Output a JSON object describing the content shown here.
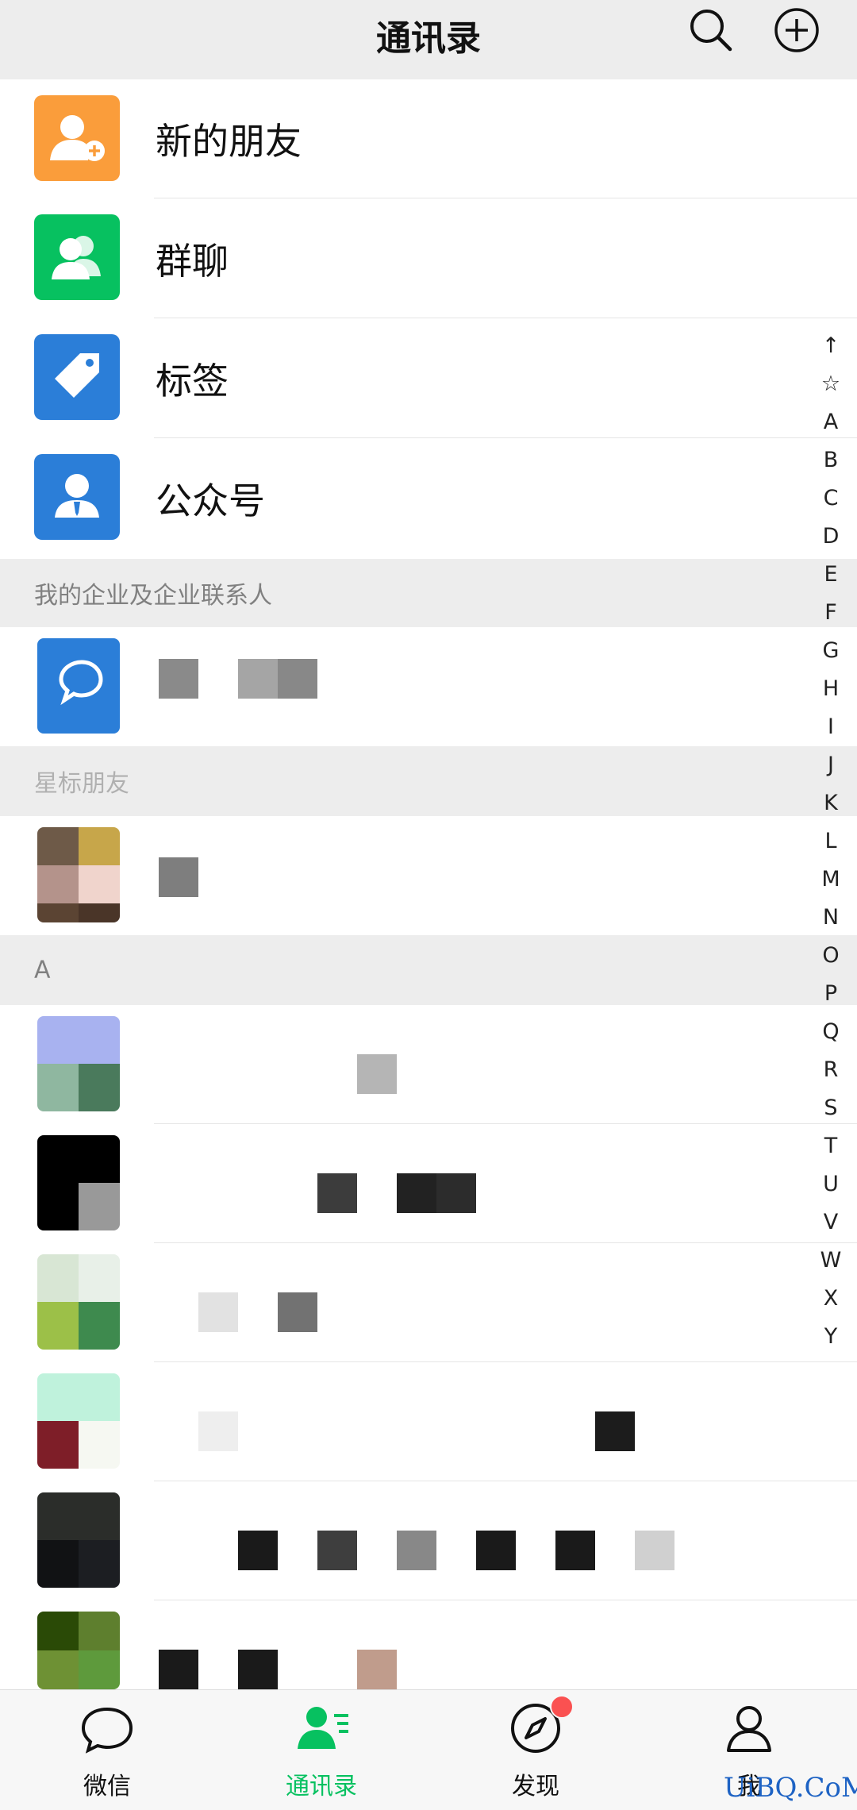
{
  "header": {
    "title": "通讯录",
    "search_icon": "search-icon",
    "add_icon": "plus-circle-icon"
  },
  "menu_items": [
    {
      "label": "新的朋友",
      "icon": "add-friend-icon",
      "color": "#fa9d3b"
    },
    {
      "label": "群聊",
      "icon": "group-chat-icon",
      "color": "#07c160"
    },
    {
      "label": "标签",
      "icon": "tag-icon",
      "color": "#2b7ed8"
    },
    {
      "label": "公众号",
      "icon": "official-account-icon",
      "color": "#2b7ed8"
    }
  ],
  "sections": {
    "enterprise": "我的企业及企业联系人",
    "starred": "星标朋友",
    "letter_a": "A"
  },
  "index_letters": [
    "↑",
    "☆",
    "A",
    "B",
    "C",
    "D",
    "E",
    "F",
    "G",
    "H",
    "I",
    "J",
    "K",
    "L",
    "M",
    "N",
    "O",
    "P",
    "Q",
    "R",
    "S",
    "T",
    "U",
    "V",
    "W",
    "X",
    "Y"
  ],
  "tabs": [
    {
      "label": "微信",
      "icon": "chat-bubble-icon",
      "active": false
    },
    {
      "label": "通讯录",
      "icon": "contacts-icon",
      "active": true
    },
    {
      "label": "发现",
      "icon": "compass-icon",
      "active": false,
      "badge": "red-dot"
    },
    {
      "label": "我",
      "icon": "person-icon",
      "active": false
    }
  ],
  "watermark": "UiBQ.CoM",
  "colors": {
    "accent": "#07c160",
    "header_bg": "#ededed",
    "section_bg": "#ededed",
    "badge": "#fa5151"
  }
}
